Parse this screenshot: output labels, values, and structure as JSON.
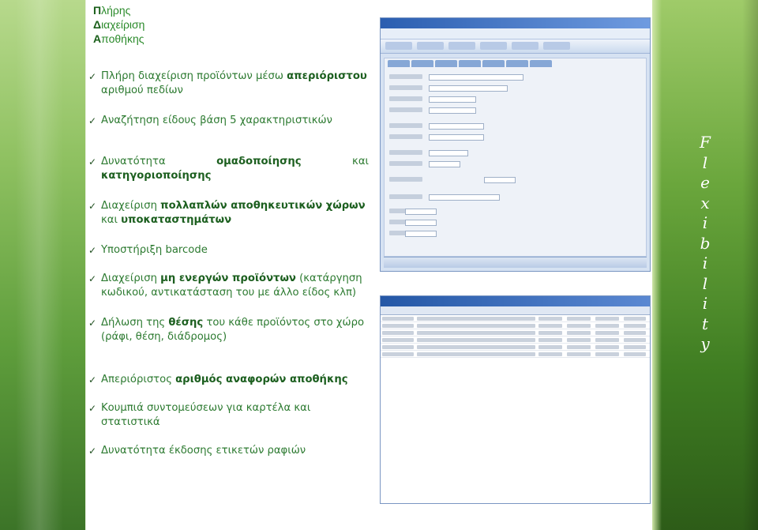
{
  "heading": {
    "word1": "Πλήρης",
    "word2": "Διαχείριση",
    "word3": "Αποθήκης"
  },
  "bullets": [
    {
      "pre": "Πλήρη διαχείριση προϊόντων μέσω ",
      "bold": "απεριόριστου",
      "post": " αριθμού πεδίων"
    },
    {
      "pre": "Αναζήτηση είδους βάση 5 χαρακτηριστικών",
      "bold": "",
      "post": ""
    },
    {
      "pre": "Δυνατότητα",
      "bold": "ομαδοποίησης",
      "post": "και",
      "line2_bold": "κατηγοριοποίησης"
    },
    {
      "pre": "Διαχείριση ",
      "bold": "πολλαπλών αποθηκευτικών χώρων",
      "post": " και ",
      "bold2": "υποκαταστημάτων"
    },
    {
      "pre": "Υποστήριξη barcode",
      "bold": "",
      "post": ""
    },
    {
      "pre": "Διαχείριση ",
      "bold": "μη ενεργών προϊόντων",
      "post": " (κατάργηση κωδικού, αντικατάσταση του με άλλο είδος κλπ)"
    },
    {
      "pre": "Δήλωση της ",
      "bold": "θέσης",
      "post": " του κάθε προϊόντος στο χώρο (ράφι, θέση, διάδρομος)"
    },
    {
      "pre": "Απεριόριστος ",
      "bold": "αριθμός αναφορών αποθήκης",
      "post": ""
    },
    {
      "pre": "Κουμπιά συντομεύσεων για καρτέλα και",
      "bold": "",
      "post": "",
      "line2": "στατιστικά"
    },
    {
      "pre": "Δυνατότητα έκδοσης ετικετών ραφιών",
      "bold": "",
      "post": ""
    }
  ],
  "vertical_word": [
    "F",
    "l",
    "e",
    "x",
    "i",
    "b",
    "i",
    "l",
    "i",
    "t",
    "y"
  ],
  "icons": {
    "check": "check-icon"
  },
  "colors": {
    "text": "#2c7a30",
    "bold": "#1c5f1f",
    "band": "#6aa63c"
  }
}
